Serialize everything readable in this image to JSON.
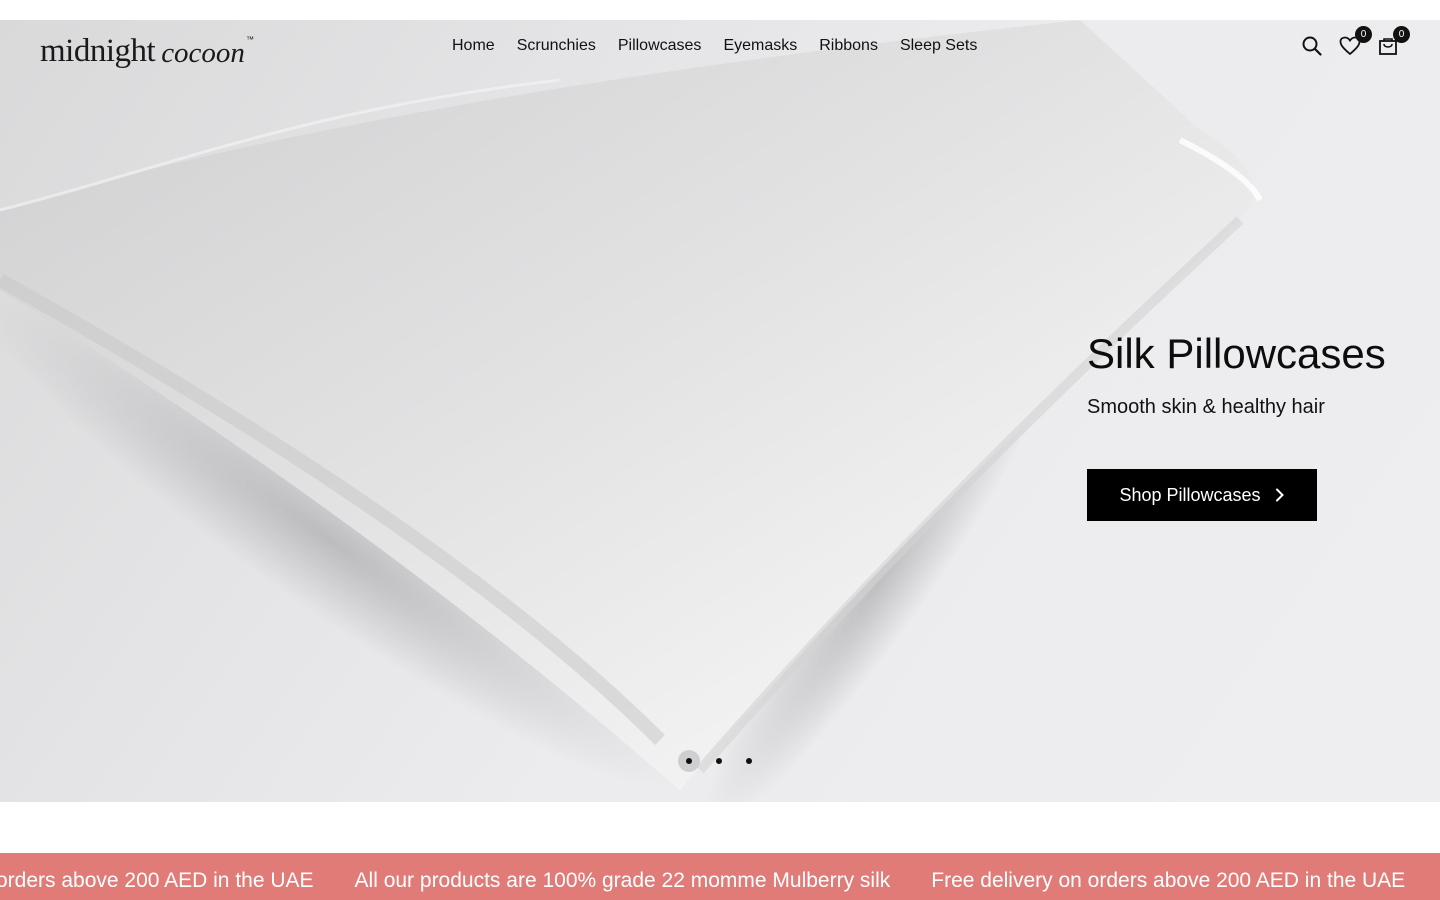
{
  "brand": {
    "name_main": "midnight",
    "name_script": "cocoon",
    "trademark": "™"
  },
  "nav": {
    "items": [
      {
        "label": "Home"
      },
      {
        "label": "Scrunchies"
      },
      {
        "label": "Pillowcases"
      },
      {
        "label": "Eyemasks"
      },
      {
        "label": "Ribbons"
      },
      {
        "label": "Sleep Sets"
      }
    ]
  },
  "header_icons": {
    "search": "search-icon",
    "wishlist": "heart-icon",
    "wishlist_count": "0",
    "cart": "bag-icon",
    "cart_count": "0"
  },
  "hero": {
    "title": "Silk Pillowcases",
    "subtitle": "Smooth skin & healthy hair",
    "cta_label": "Shop Pillowcases",
    "cta_icon": "chevron-right-icon",
    "slides": {
      "count": 3,
      "active": 1
    }
  },
  "announcement": {
    "messages": [
      "orders above 200 AED in the UAE",
      "All our products are 100% grade 22 momme Mulberry silk",
      "Free delivery on orders above 200 AED in the UAE"
    ],
    "background": "#e07b78"
  },
  "colors": {
    "accent": "#000000",
    "ticker": "#e07b78"
  }
}
